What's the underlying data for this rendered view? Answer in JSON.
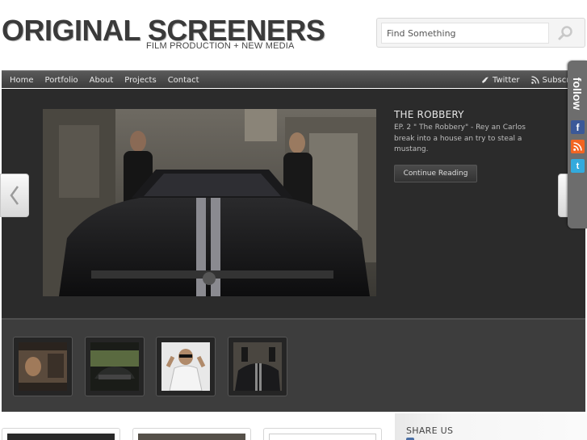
{
  "header": {
    "logo_title": "ORIGINAL SCREENERS",
    "logo_subtitle": "FILM PRODUCTION + NEW MEDIA",
    "search_placeholder": "Find Something"
  },
  "nav": {
    "items": [
      {
        "label": "Home"
      },
      {
        "label": "Portfolio"
      },
      {
        "label": "About"
      },
      {
        "label": "Projects"
      },
      {
        "label": "Contact"
      }
    ],
    "right": [
      {
        "label": "Twitter",
        "icon": "twitter-bird-icon"
      },
      {
        "label": "Subscribe",
        "icon": "rss-icon"
      }
    ]
  },
  "featured": {
    "title": "THE ROBBERY",
    "description": "EP. 2 \" The Robbery\" - Rey an Carlos break into a house an try to steal a mustang.",
    "button_label": "Continue Reading"
  },
  "follow": {
    "label": "follow",
    "icons": [
      "facebook-icon",
      "rss-icon",
      "twitter-icon"
    ]
  },
  "sidebar": {
    "share_title": "SHARE US"
  },
  "colors": {
    "nav_bg": "#4a4a4a",
    "slider_bg": "#2b2b2b",
    "thumbs_bg": "#3d3d3d",
    "facebook": "#3b5998",
    "rss": "#f26522",
    "twitter": "#33ccff"
  }
}
